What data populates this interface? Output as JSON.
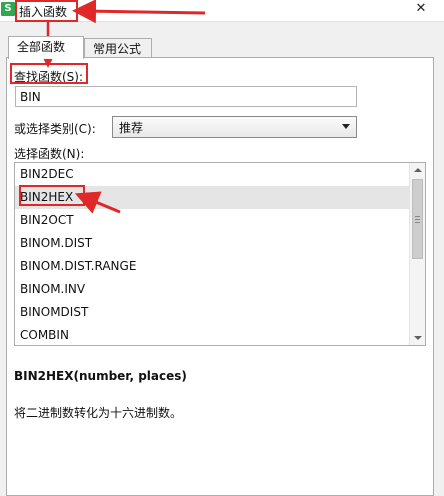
{
  "window": {
    "app_icon": "S",
    "title": "插入函数",
    "close_glyph": "✕"
  },
  "tabs": [
    {
      "label": "全部函数",
      "active": true
    },
    {
      "label": "常用公式",
      "active": false
    }
  ],
  "search": {
    "label": "查找函数(S):",
    "value": "BIN"
  },
  "category": {
    "label": "或选择类别(C):",
    "selected": "推荐"
  },
  "function_list": {
    "label": "选择函数(N):",
    "items": [
      "BIN2DEC",
      "BIN2HEX",
      "BIN2OCT",
      "BINOM.DIST",
      "BINOM.DIST.RANGE",
      "BINOM.INV",
      "BINOMDIST",
      "COMBIN"
    ],
    "selected_index": 1
  },
  "details": {
    "signature": "BIN2HEX(number, places)",
    "description": "将二进制数转化为十六进制数。"
  },
  "colors": {
    "annotation_red": "#e02828",
    "app_icon_green": "#2fa84f"
  }
}
